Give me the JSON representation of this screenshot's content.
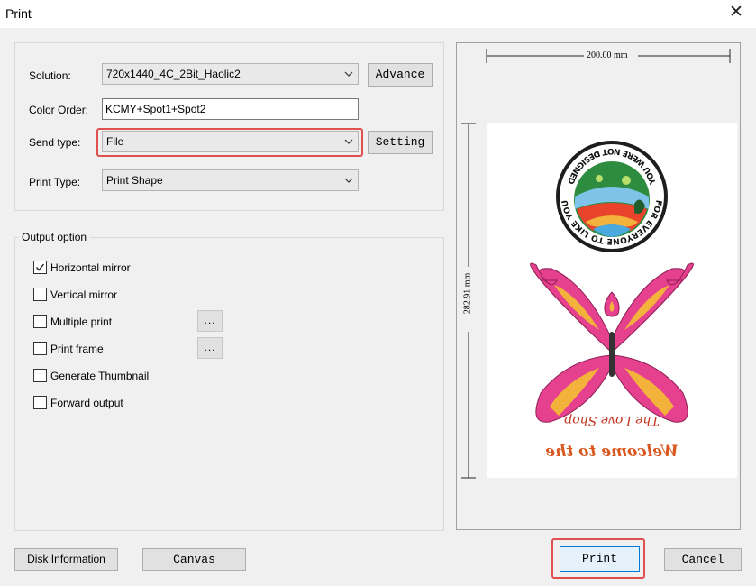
{
  "window": {
    "title": "Print",
    "close_glyph": "✕"
  },
  "settings": {
    "solution_label": "Solution:",
    "solution_value": "720x1440_4C_2Bit_Haolic2",
    "advance_button": "Advance",
    "color_order_label": "Color Order:",
    "color_order_value": "KCMY+Spot1+Spot2",
    "send_type_label": "Send type:",
    "send_type_value": "File",
    "setting_button": "Setting",
    "print_type_label": "Print Type:",
    "print_type_value": "Print Shape"
  },
  "output_option": {
    "title": "Output option",
    "options": [
      {
        "label": "Horizontal mirror",
        "checked": true
      },
      {
        "label": "Vertical mirror",
        "checked": false
      },
      {
        "label": "Multiple print",
        "checked": false
      },
      {
        "label": "Print frame",
        "checked": false
      },
      {
        "label": "Generate Thumbnail",
        "checked": false
      },
      {
        "label": "Forward output",
        "checked": false
      }
    ],
    "more_button": "..."
  },
  "preview": {
    "width_label": "200.00 mm",
    "height_label": "282.91 mm",
    "image_text_top": "FOR EVERYONE TO LIKE YOU",
    "image_text_bottom": "YOU WERE NOT DESIGNED",
    "image_caption_1": "The Love Shop",
    "image_caption_2": "Welcome to the"
  },
  "footer": {
    "disk_info_button": "Disk Information",
    "canvas_button": "Canvas",
    "print_button": "Print",
    "cancel_button": "Cancel"
  },
  "colors": {
    "highlight": "#e0504f",
    "butterfly_pink": "#e6418e",
    "butterfly_gold": "#f3b23c"
  }
}
